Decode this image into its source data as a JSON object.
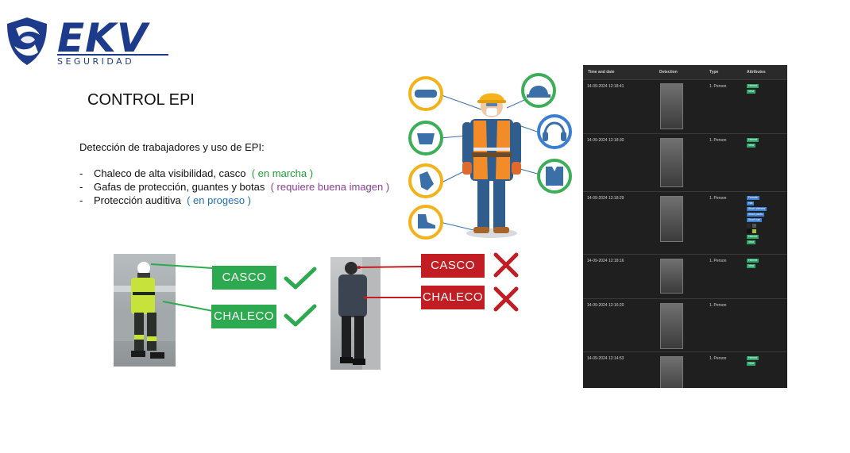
{
  "brand": {
    "name": "EKV",
    "tagline": "SEGURIDAD",
    "color": "#1d3b8a"
  },
  "title": "CONTROL EPI",
  "intro": "Detección de trabajadores y uso de EPI:",
  "features": [
    {
      "bullet": "-",
      "text": "Chaleco de alta visibilidad, casco",
      "status": "( en marcha )",
      "status_color": "#1f9d3c"
    },
    {
      "bullet": "-",
      "text": "Gafas de protección, guantes y botas",
      "status": "( requiere buena imagen )",
      "status_color": "#8a3d98"
    },
    {
      "bullet": "-",
      "text": "Protección auditiva",
      "status": "( en progeso )",
      "status_color": "#1f6fb8"
    }
  ],
  "ppe_icons": [
    "goggles-icon",
    "hard-hat-icon",
    "face-mask-icon",
    "ear-muffs-icon",
    "gloves-icon",
    "safety-vest-icon",
    "safety-boots-icon"
  ],
  "example_ok": {
    "helmet_label": "CASCO",
    "vest_label": "CHALECO",
    "status_icon": "check-icon",
    "color": "#2daa4f"
  },
  "example_fail": {
    "helmet_label": "CASCO",
    "vest_label": "CHALECO",
    "status_icon": "cross-icon",
    "color": "#c21d22"
  },
  "detection_table": {
    "columns": [
      "Time and date",
      "Detection",
      "Type",
      "Attributes"
    ],
    "rows": [
      {
        "time": "14-09-2024 12:18:41",
        "type": "1. Person",
        "attributes": [
          "Helmet",
          "Vest"
        ]
      },
      {
        "time": "14-09-2024 12:18:30",
        "type": "1. Person",
        "attributes": [
          "Helmet",
          "Vest"
        ]
      },
      {
        "time": "14-09-2024 12:18:29",
        "type": "1. Person",
        "tags": [
          "Female",
          "Hat",
          "Short sleeves",
          "Short pants",
          "Short hair"
        ],
        "attributes": [
          "Helmet",
          "Vest"
        ]
      },
      {
        "time": "14-09-2024 12:18:16",
        "type": "1. Person",
        "attributes": [
          "Helmet",
          "Vest"
        ]
      },
      {
        "time": "14-09-2024 12:16:20",
        "type": "1. Person",
        "attributes": []
      },
      {
        "time": "14-09-2024 12:14:53",
        "type": "1. Person",
        "attributes": [
          "Helmet",
          "Vest"
        ]
      }
    ]
  }
}
